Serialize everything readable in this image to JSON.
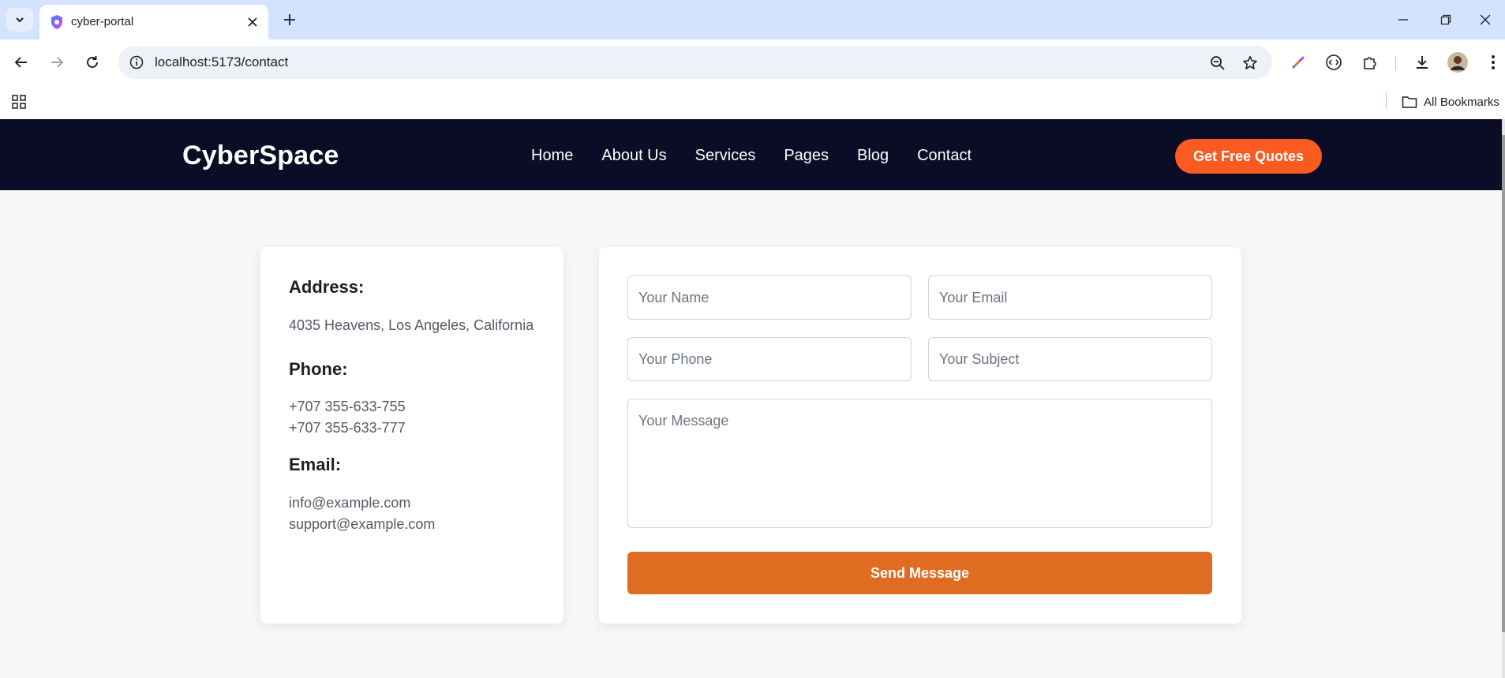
{
  "browser": {
    "tab_title": "cyber-portal",
    "url": "localhost:5173/contact",
    "bookmarks_label": "All Bookmarks",
    "colors": {
      "tabstrip": "#d3e3fd",
      "omnibox": "#eef2f8"
    }
  },
  "site": {
    "logo": "CyberSpace",
    "menu": [
      "Home",
      "About Us",
      "Services",
      "Pages",
      "Blog",
      "Contact"
    ],
    "cta_label": "Get Free Quotes",
    "colors": {
      "nav_bg": "#0b0c26",
      "cta": "#fb5b21",
      "send": "#e06c22"
    }
  },
  "contact_info": {
    "address_title": "Address:",
    "address": "4035 Heavens, Los Angeles, California",
    "phone_title": "Phone:",
    "phones": [
      "+707 355-633-755",
      "+707 355-633-777"
    ],
    "email_title": "Email:",
    "emails": [
      "info@example.com",
      "support@example.com"
    ]
  },
  "form": {
    "name_placeholder": "Your Name",
    "email_placeholder": "Your Email",
    "phone_placeholder": "Your Phone",
    "subject_placeholder": "Your Subject",
    "message_placeholder": "Your Message",
    "submit_label": "Send Message"
  }
}
